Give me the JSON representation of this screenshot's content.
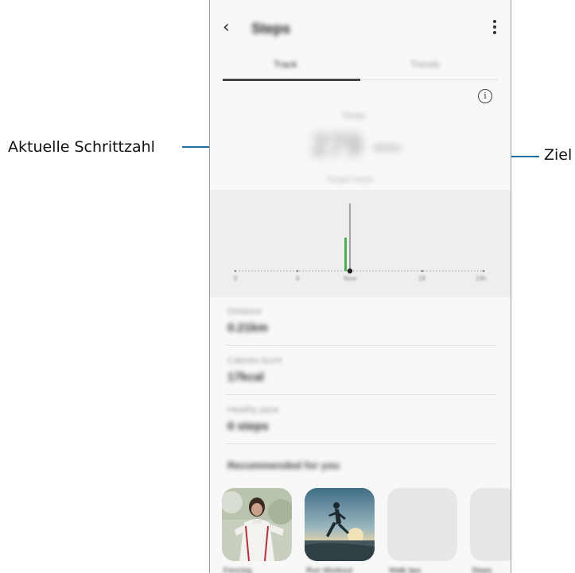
{
  "annotations": {
    "current_steps": "Aktuelle Schrittzahl",
    "goal": "Ziel"
  },
  "header": {
    "title": "Steps",
    "back_icon": "chevron-left-icon",
    "menu_icon": "more-vertical-icon"
  },
  "tabs": [
    {
      "label": "Track",
      "selected": true
    },
    {
      "label": "Trends",
      "selected": false
    }
  ],
  "summary": {
    "today_label": "Today",
    "steps": "279",
    "goal": "/6000",
    "goal_label": "Target steps"
  },
  "chart_data": {
    "type": "bar",
    "x_ticks": [
      "0",
      "6",
      "Now",
      "18",
      "24h"
    ],
    "current_marker": "Now"
  },
  "stats": [
    {
      "label": "Distance",
      "value": "0.21km"
    },
    {
      "label": "Calories burnt",
      "value": "17kcal"
    },
    {
      "label": "Healthy pace",
      "value": "0 steps"
    }
  ],
  "recommended": {
    "title": "Recommended for you",
    "cards": [
      {
        "label": "Fencing"
      },
      {
        "label": "Run Workout"
      },
      {
        "label": "Walk tips"
      },
      {
        "label": "Steps"
      }
    ]
  },
  "colors": {
    "accent_green": "#4caf50",
    "annotation_line": "#1d6fa3"
  }
}
